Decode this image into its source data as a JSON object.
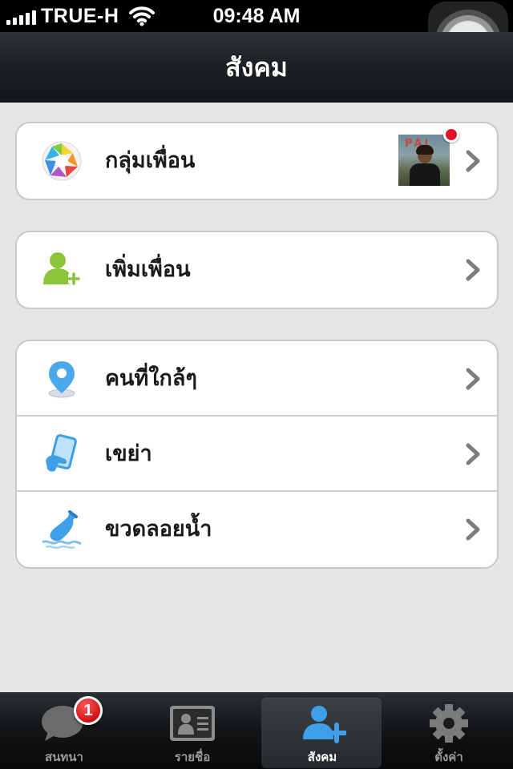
{
  "status_bar": {
    "carrier": "TRUE-H",
    "time": "09:48 AM",
    "signal_bars": 5,
    "icons": [
      "signal-icon",
      "wifi-icon",
      "lock-rotation-icon",
      "battery-charging-icon"
    ]
  },
  "nav": {
    "title": "สังคม"
  },
  "groups": [
    {
      "rows": [
        {
          "label": "กลุ่มเพื่อน",
          "icon": "moments-aperture-icon",
          "has_thumbnail": true,
          "thumbnail_text": "PAI",
          "has_notification_dot": true
        }
      ]
    },
    {
      "rows": [
        {
          "label": "เพิ่มเพื่อน",
          "icon": "add-friend-icon"
        }
      ]
    },
    {
      "rows": [
        {
          "label": "คนที่ใกล้ๆ",
          "icon": "location-pin-icon"
        },
        {
          "label": "เขย่า",
          "icon": "shake-phone-icon"
        },
        {
          "label": "ขวดลอยน้ำ",
          "icon": "drift-bottle-icon"
        }
      ]
    }
  ],
  "tabs": [
    {
      "label": "สนทนา",
      "icon": "chat-bubble-icon",
      "badge": "1",
      "selected": false
    },
    {
      "label": "รายชื่อ",
      "icon": "contacts-card-icon",
      "selected": false
    },
    {
      "label": "สังคม",
      "icon": "add-friend-icon",
      "selected": true
    },
    {
      "label": "ตั้งค่า",
      "icon": "gear-icon",
      "selected": false
    }
  ],
  "colors": {
    "background": "#e6e5e3",
    "nav_bar": "#1c2023",
    "accent_blue": "#3f9fe8",
    "badge_red": "#d40f14",
    "add_friend_green": "#8bc43a"
  }
}
